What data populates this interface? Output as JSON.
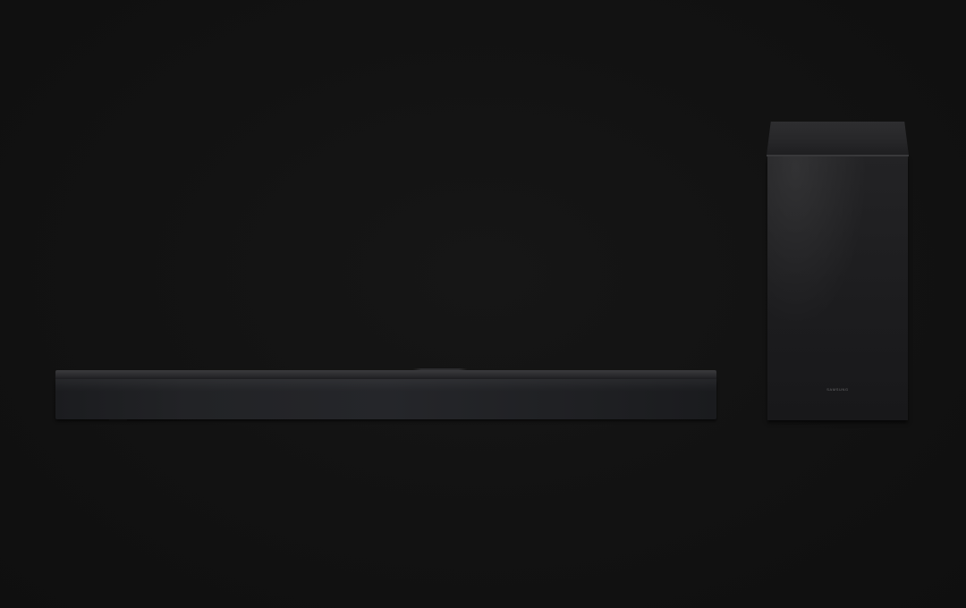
{
  "scene": {
    "background_color": "#111111",
    "objects": [
      "soundbar",
      "subwoofer"
    ]
  },
  "soundbar": {
    "color": "#222326"
  },
  "subwoofer": {
    "color": "#1d1d1f",
    "logo_text": "SAMSUNG"
  }
}
